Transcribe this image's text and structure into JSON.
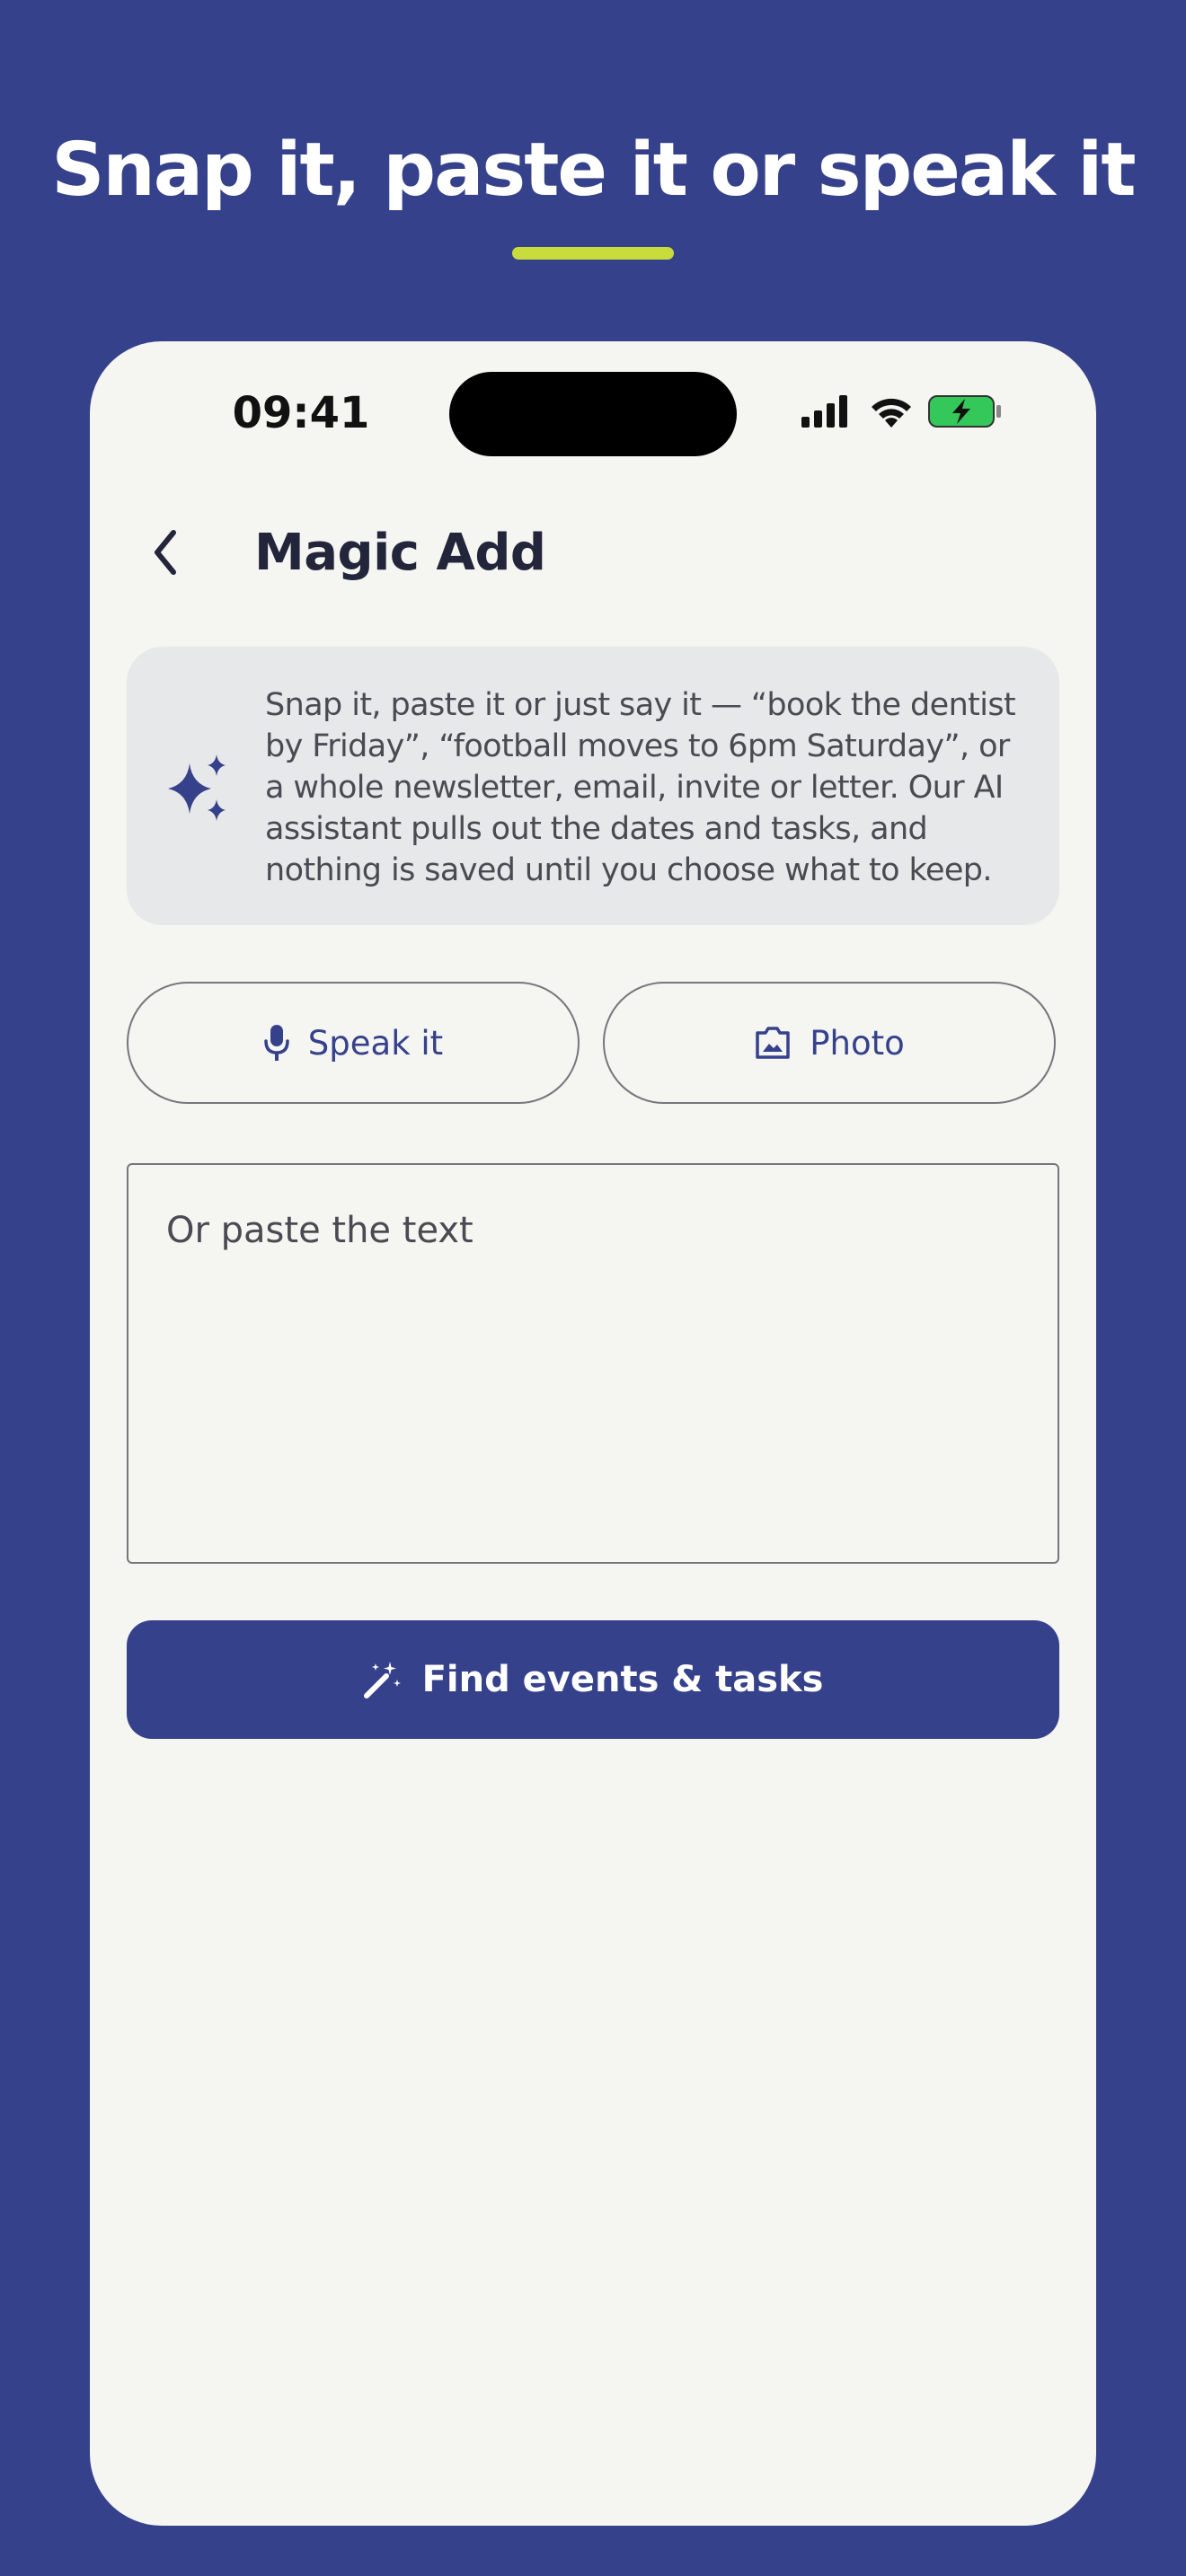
{
  "headline": {
    "text": "Snap it, paste it or speak it",
    "underline_color": "#c8dc3c",
    "background_color": "#36418c"
  },
  "status_bar": {
    "time": "09:41",
    "icons": [
      "cellular-signal-icon",
      "wifi-icon",
      "battery-charging-icon"
    ]
  },
  "header": {
    "back_icon": "chevron-left-icon",
    "title": "Magic Add"
  },
  "info_card": {
    "icon": "sparkle-icon",
    "text": "Snap it, paste it or just say it — “book the dentist by Friday”, “football moves to 6pm Saturday”, or a whole newsletter, email, invite or letter. Our AI assistant pulls out the dates and tasks, and nothing is saved until you choose what to keep."
  },
  "actions": {
    "speak": {
      "label": "Speak it",
      "icon": "microphone-icon"
    },
    "photo": {
      "label": "Photo",
      "icon": "photo-icon"
    }
  },
  "paste_input": {
    "placeholder": "Or paste the text",
    "value": ""
  },
  "primary_button": {
    "label": "Find events & tasks",
    "icon": "magic-wand-icon",
    "color": "#36418c"
  }
}
